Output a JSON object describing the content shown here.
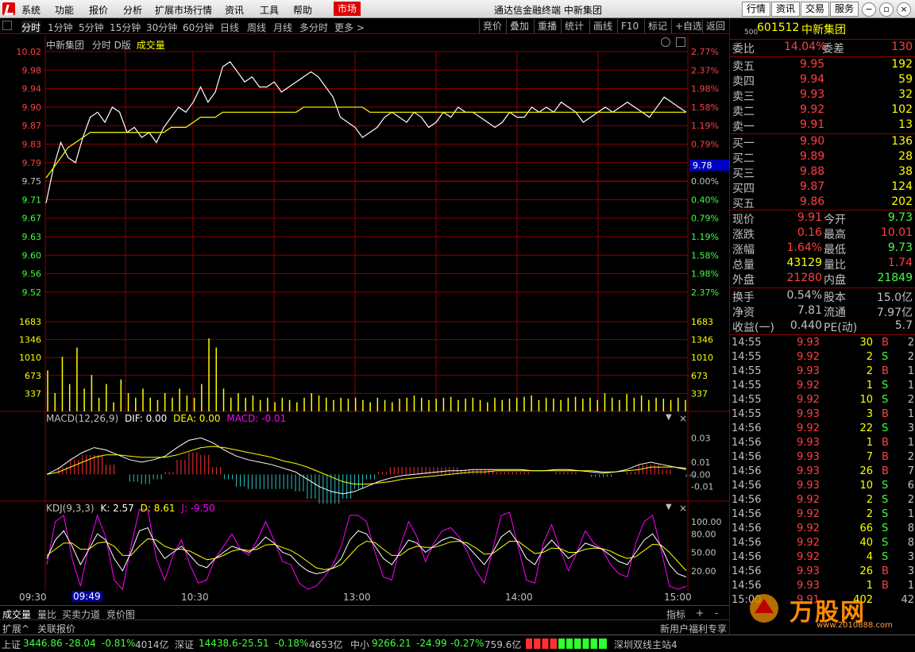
{
  "menu": {
    "items": [
      "系统",
      "功能",
      "报价",
      "分析",
      "扩展市场行情",
      "资讯",
      "工具",
      "帮助"
    ],
    "active_item": "市场",
    "window_title": "通达信金融终端  中新集团",
    "right_buttons": [
      "行情",
      "资讯",
      "交易",
      "服务"
    ]
  },
  "tabs": {
    "left": [
      "分时",
      "1分钟",
      "5分钟",
      "15分钟",
      "30分钟",
      "60分钟",
      "日线",
      "周线",
      "月线",
      "多分时",
      "更多 >"
    ],
    "right": [
      "竞价",
      "叠加",
      "重播",
      "统计",
      "画线",
      "F10",
      "标记",
      "+自选",
      "返回"
    ]
  },
  "chart_header": {
    "name": "中新集团",
    "mode": "分时 D版",
    "indicator": "成交量"
  },
  "chart_data": [
    {
      "type": "line",
      "name": "price",
      "y_left_ticks": [
        "10.02",
        "9.98",
        "9.94",
        "9.90",
        "9.87",
        "9.83",
        "9.79",
        "9.75",
        "9.71",
        "9.67",
        "9.63",
        "9.60",
        "9.56",
        "9.52"
      ],
      "y_right_ticks": [
        "2.77%",
        "2.37%",
        "1.98%",
        "1.58%",
        "1.19%",
        "0.79%",
        "0.40%",
        "0.00%",
        "0.40%",
        "0.79%",
        "1.19%",
        "1.58%",
        "1.98%",
        "2.37%"
      ],
      "prev_close": 9.75,
      "current_marker": "9.78",
      "ylim": [
        9.5,
        10.03
      ],
      "series": [
        {
          "name": "price",
          "color": "#ffffff",
          "values": [
            9.73,
            9.8,
            9.85,
            9.82,
            9.81,
            9.86,
            9.9,
            9.91,
            9.89,
            9.92,
            9.91,
            9.87,
            9.88,
            9.86,
            9.87,
            9.85,
            9.88,
            9.9,
            9.92,
            9.91,
            9.93,
            9.96,
            9.93,
            9.95,
            10.0,
            10.01,
            9.99,
            9.97,
            9.98,
            9.96,
            9.96,
            9.97,
            9.95,
            9.96,
            9.97,
            9.98,
            9.99,
            9.98,
            9.96,
            9.94,
            9.9,
            9.89,
            9.88,
            9.86,
            9.87,
            9.88,
            9.9,
            9.91,
            9.9,
            9.89,
            9.91,
            9.9,
            9.88,
            9.89,
            9.91,
            9.9,
            9.92,
            9.91,
            9.91,
            9.9,
            9.89,
            9.88,
            9.89,
            9.91,
            9.9,
            9.9,
            9.92,
            9.91,
            9.92,
            9.91,
            9.93,
            9.92,
            9.91,
            9.89,
            9.9,
            9.91,
            9.92,
            9.91,
            9.92,
            9.93,
            9.92,
            9.91,
            9.9,
            9.92,
            9.94,
            9.93,
            9.92,
            9.91
          ]
        },
        {
          "name": "avg",
          "color": "#ffff00",
          "values": [
            9.78,
            9.8,
            9.82,
            9.84,
            9.85,
            9.86,
            9.87,
            9.87,
            9.87,
            9.87,
            9.87,
            9.87,
            9.87,
            9.87,
            9.87,
            9.87,
            9.87,
            9.88,
            9.88,
            9.88,
            9.89,
            9.9,
            9.9,
            9.9,
            9.91,
            9.91,
            9.91,
            9.91,
            9.91,
            9.91,
            9.91,
            9.91,
            9.91,
            9.91,
            9.91,
            9.92,
            9.92,
            9.92,
            9.92,
            9.92,
            9.92,
            9.92,
            9.92,
            9.92,
            9.91,
            9.91,
            9.91,
            9.91,
            9.91,
            9.91,
            9.91,
            9.91,
            9.91,
            9.91,
            9.91,
            9.91,
            9.91,
            9.91,
            9.91,
            9.91,
            9.91,
            9.91,
            9.91,
            9.91,
            9.91,
            9.91,
            9.91,
            9.91,
            9.91,
            9.91,
            9.91,
            9.91,
            9.91,
            9.91,
            9.91,
            9.91,
            9.91,
            9.91,
            9.91,
            9.91,
            9.91,
            9.91,
            9.91,
            9.91,
            9.91,
            9.91,
            9.91,
            9.91
          ]
        }
      ]
    },
    {
      "type": "bar",
      "name": "volume",
      "y_ticks": [
        "1683",
        "1346",
        "1010",
        "673",
        "337"
      ],
      "ylim": [
        0,
        2020
      ],
      "values": [
        900,
        400,
        1200,
        600,
        1400,
        500,
        800,
        300,
        600,
        200,
        700,
        400,
        300,
        500,
        300,
        250,
        400,
        300,
        500,
        350,
        300,
        600,
        1600,
        1400,
        500,
        300,
        400,
        300,
        350,
        250,
        300,
        200,
        300,
        250,
        200,
        300,
        400,
        350,
        300,
        250,
        300,
        280,
        300,
        250,
        200,
        300,
        250,
        200,
        280,
        300,
        350,
        300,
        250,
        280,
        300,
        320,
        250,
        280,
        300,
        250,
        200,
        300,
        250,
        280,
        300,
        320,
        350,
        250,
        300,
        280,
        250,
        300,
        320,
        280,
        300,
        250,
        400,
        300,
        250,
        380,
        300,
        350,
        250,
        300,
        280,
        250,
        300,
        250
      ]
    },
    {
      "type": "line",
      "name": "MACD",
      "label": "MACD(12,26,9)",
      "dif_label": "DIF: 0.00",
      "dea_label": "DEA: 0.00",
      "macd_label": "MACD: -0.01",
      "y_ticks": [
        "0.03",
        "0.01",
        "0.00",
        "-0.01"
      ],
      "ylim": [
        -0.02,
        0.04
      ],
      "dif": [
        0.0,
        0.005,
        0.012,
        0.018,
        0.022,
        0.02,
        0.016,
        0.012,
        0.01,
        0.012,
        0.015,
        0.022,
        0.028,
        0.03,
        0.026,
        0.02,
        0.015,
        0.012,
        0.01,
        0.008,
        0.005,
        0.002,
        -0.004,
        -0.01,
        -0.014,
        -0.016,
        -0.014,
        -0.01,
        -0.006,
        -0.003,
        -0.001,
        0.0,
        0.001,
        0.002,
        0.003,
        0.003,
        0.004,
        0.004,
        0.004,
        0.004,
        0.004,
        0.003,
        0.003,
        0.004,
        0.004,
        0.003,
        0.002,
        0.001,
        0.002,
        0.004,
        0.008,
        0.01,
        0.008,
        0.006,
        0.004
      ],
      "dea": [
        0.0,
        0.002,
        0.006,
        0.01,
        0.014,
        0.016,
        0.016,
        0.015,
        0.014,
        0.014,
        0.014,
        0.016,
        0.019,
        0.022,
        0.023,
        0.022,
        0.02,
        0.018,
        0.016,
        0.014,
        0.011,
        0.009,
        0.006,
        0.002,
        -0.002,
        -0.006,
        -0.008,
        -0.008,
        -0.007,
        -0.006,
        -0.004,
        -0.003,
        -0.002,
        -0.001,
        0.0,
        0.001,
        0.002,
        0.002,
        0.003,
        0.003,
        0.003,
        0.003,
        0.003,
        0.003,
        0.003,
        0.003,
        0.003,
        0.002,
        0.002,
        0.003,
        0.004,
        0.006,
        0.006,
        0.006,
        0.005
      ]
    },
    {
      "type": "line",
      "name": "KDJ",
      "label": "KDJ(9,3,3)",
      "k_label": "K: 2.57",
      "d_label": "D: 8.61",
      "j_label": "J: -9.50",
      "y_ticks": [
        "100.00",
        "80.00",
        "50.00",
        "20.00"
      ],
      "ylim": [
        -10,
        110
      ],
      "k": [
        40,
        70,
        85,
        60,
        30,
        55,
        80,
        70,
        40,
        20,
        50,
        85,
        90,
        60,
        40,
        50,
        60,
        45,
        30,
        25,
        40,
        50,
        60,
        55,
        50,
        60,
        75,
        65,
        50,
        45,
        30,
        20,
        15,
        18,
        25,
        40,
        70,
        85,
        80,
        60,
        40,
        30,
        50,
        70,
        65,
        50,
        60,
        70,
        75,
        70,
        60,
        45,
        30,
        50,
        75,
        85,
        65,
        40,
        30,
        55,
        70,
        55,
        40,
        50,
        65,
        60,
        55,
        45,
        35,
        30,
        50,
        70,
        80,
        60,
        30,
        15,
        10
      ],
      "d": [
        45,
        55,
        65,
        65,
        55,
        55,
        65,
        67,
        60,
        45,
        45,
        60,
        72,
        70,
        60,
        55,
        55,
        52,
        45,
        38,
        40,
        45,
        52,
        55,
        53,
        55,
        62,
        63,
        58,
        53,
        45,
        35,
        25,
        22,
        24,
        30,
        45,
        60,
        68,
        66,
        55,
        45,
        45,
        55,
        60,
        58,
        58,
        62,
        67,
        68,
        65,
        57,
        47,
        48,
        58,
        68,
        68,
        58,
        48,
        50,
        57,
        56,
        50,
        50,
        55,
        57,
        56,
        52,
        45,
        40,
        43,
        53,
        63,
        62,
        50,
        35,
        20
      ],
      "j": [
        30,
        100,
        110,
        40,
        -5,
        60,
        110,
        75,
        5,
        -10,
        60,
        120,
        120,
        40,
        5,
        45,
        70,
        30,
        0,
        5,
        40,
        60,
        80,
        55,
        45,
        70,
        100,
        70,
        35,
        30,
        0,
        -10,
        -5,
        10,
        30,
        60,
        110,
        110,
        100,
        50,
        10,
        5,
        60,
        100,
        75,
        35,
        65,
        85,
        90,
        75,
        50,
        20,
        0,
        55,
        110,
        115,
        60,
        5,
        0,
        65,
        95,
        55,
        20,
        50,
        85,
        65,
        55,
        30,
        15,
        10,
        65,
        100,
        110,
        55,
        -5,
        -10,
        -5
      ]
    }
  ],
  "time_axis": [
    "09:30",
    "09:49",
    "10:30",
    "13:00",
    "14:00",
    "15:00"
  ],
  "bottom_tabs": [
    "成交量",
    "量比",
    "买卖力道",
    "竞价图"
  ],
  "bottom_tabs2": [
    "扩展^",
    "关联报价"
  ],
  "bottom_right": [
    "指标",
    "+",
    "-"
  ],
  "promo": "新用户福利专享",
  "stock": {
    "code": "601512",
    "name": "中新集团",
    "prefix": "500"
  },
  "order_ratio": {
    "label_wb": "委比",
    "wb": "14.04%",
    "label_wc": "委差",
    "wc": "130"
  },
  "asks": [
    {
      "label": "卖五",
      "price": "9.95",
      "vol": "192"
    },
    {
      "label": "卖四",
      "price": "9.94",
      "vol": "59"
    },
    {
      "label": "卖三",
      "price": "9.93",
      "vol": "32"
    },
    {
      "label": "卖二",
      "price": "9.92",
      "vol": "102"
    },
    {
      "label": "卖一",
      "price": "9.91",
      "vol": "13"
    }
  ],
  "bids": [
    {
      "label": "买一",
      "price": "9.90",
      "vol": "136"
    },
    {
      "label": "买二",
      "price": "9.89",
      "vol": "28"
    },
    {
      "label": "买三",
      "price": "9.88",
      "vol": "38"
    },
    {
      "label": "买四",
      "price": "9.87",
      "vol": "124"
    },
    {
      "label": "买五",
      "price": "9.86",
      "vol": "202"
    }
  ],
  "quote": [
    {
      "l1": "现价",
      "v1": "9.91",
      "l2": "今开",
      "v2": "9.73",
      "c1": "#ff4040",
      "c2": "#40ff40"
    },
    {
      "l1": "涨跌",
      "v1": "0.16",
      "l2": "最高",
      "v2": "10.01",
      "c1": "#ff4040",
      "c2": "#ff4040"
    },
    {
      "l1": "涨幅",
      "v1": "1.64%",
      "l2": "最低",
      "v2": "9.73",
      "c1": "#ff4040",
      "c2": "#40ff40"
    },
    {
      "l1": "总量",
      "v1": "43129",
      "l2": "量比",
      "v2": "1.74",
      "c1": "#ffff00",
      "c2": "#ff4040"
    },
    {
      "l1": "外盘",
      "v1": "21280",
      "l2": "内盘",
      "v2": "21849",
      "c1": "#ff4040",
      "c2": "#40ff40"
    }
  ],
  "fundamentals": [
    {
      "l1": "换手",
      "v1": "0.54%",
      "l2": "股本",
      "v2": "15.0亿"
    },
    {
      "l1": "净资",
      "v1": "7.81",
      "l2": "流通",
      "v2": "7.97亿"
    },
    {
      "l1": "收益(一)",
      "v1": "0.440",
      "l2": "PE(动)",
      "v2": "5.7"
    }
  ],
  "ticks": [
    {
      "t": "14:55",
      "p": "9.93",
      "v": "30",
      "s": "B",
      "n": "2"
    },
    {
      "t": "14:55",
      "p": "9.92",
      "v": "2",
      "s": "S",
      "n": "2"
    },
    {
      "t": "14:55",
      "p": "9.93",
      "v": "2",
      "s": "B",
      "n": "1"
    },
    {
      "t": "14:55",
      "p": "9.92",
      "v": "1",
      "s": "S",
      "n": "1"
    },
    {
      "t": "14:55",
      "p": "9.92",
      "v": "10",
      "s": "S",
      "n": "2"
    },
    {
      "t": "14:55",
      "p": "9.93",
      "v": "3",
      "s": "B",
      "n": "1"
    },
    {
      "t": "14:56",
      "p": "9.92",
      "v": "22",
      "s": "S",
      "n": "3"
    },
    {
      "t": "14:56",
      "p": "9.93",
      "v": "1",
      "s": "B",
      "n": "1"
    },
    {
      "t": "14:56",
      "p": "9.93",
      "v": "7",
      "s": "B",
      "n": "2"
    },
    {
      "t": "14:56",
      "p": "9.93",
      "v": "26",
      "s": "B",
      "n": "7"
    },
    {
      "t": "14:56",
      "p": "9.93",
      "v": "10",
      "s": "S",
      "n": "6"
    },
    {
      "t": "14:56",
      "p": "9.92",
      "v": "2",
      "s": "S",
      "n": "2"
    },
    {
      "t": "14:56",
      "p": "9.92",
      "v": "2",
      "s": "S",
      "n": "1"
    },
    {
      "t": "14:56",
      "p": "9.92",
      "v": "66",
      "s": "S",
      "n": "8"
    },
    {
      "t": "14:56",
      "p": "9.92",
      "v": "40",
      "s": "S",
      "n": "8"
    },
    {
      "t": "14:56",
      "p": "9.92",
      "v": "4",
      "s": "S",
      "n": "3"
    },
    {
      "t": "14:56",
      "p": "9.93",
      "v": "26",
      "s": "B",
      "n": "3"
    },
    {
      "t": "14:56",
      "p": "9.93",
      "v": "1",
      "s": "B",
      "n": "1"
    },
    {
      "t": "15:00",
      "p": "9.91",
      "v": "402",
      "s": "",
      "n": "42"
    }
  ],
  "status": {
    "sh_label": "上证",
    "sh_val": "3446.86",
    "sh_chg": "-28.04",
    "sh_pct": "-0.81%",
    "sh_amt": "4014亿",
    "sz_label": "深证",
    "sz_val": "14438.6",
    "sz_chg": "-25.51",
    "sz_pct": "-0.18%",
    "sz_amt": "4653亿",
    "zx_label": "中小",
    "zx_val": "9266.21",
    "zx_chg": "-24.99",
    "zx_pct": "-0.27%",
    "zx_amt": "759.6亿",
    "server": "深圳双线主站4"
  },
  "watermark": {
    "text": "万股网",
    "url": "www.2010888.com"
  },
  "colors": {
    "up": "#ff4040",
    "down": "#40ff40",
    "grid": "#8b0000",
    "price_line": "#ffffff",
    "avg_line": "#ffff00",
    "macd_up": "#ff3030",
    "macd_down": "#30c0c0",
    "dea": "#ffff00",
    "dif": "#ffffff",
    "k": "#ffffff",
    "d": "#ffff00",
    "j": "#ff00ff"
  }
}
